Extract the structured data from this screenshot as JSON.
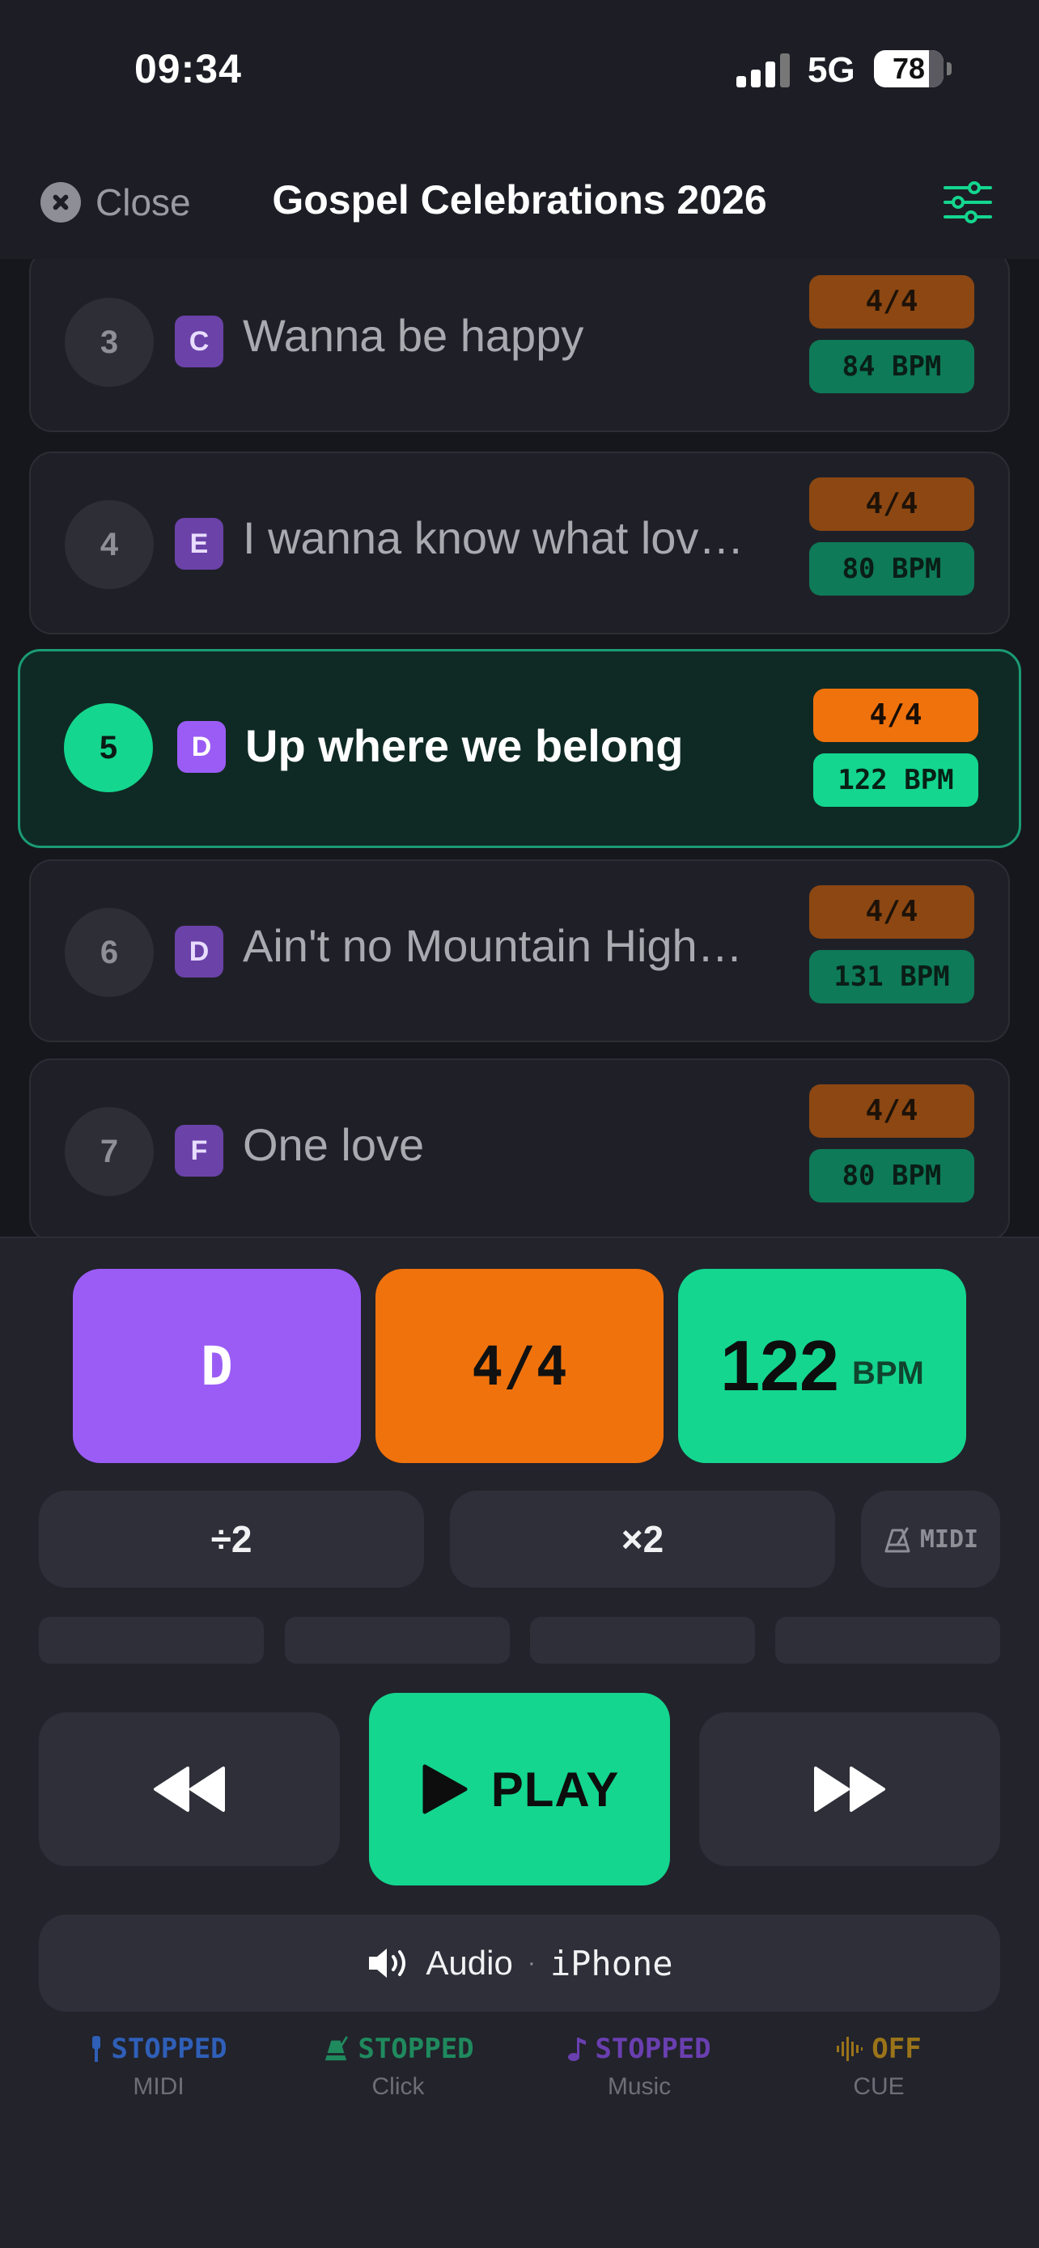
{
  "status_bar": {
    "time": "09:34",
    "network": "5G",
    "battery": "78"
  },
  "header": {
    "close_label": "Close",
    "title": "Gospel Celebrations 2026"
  },
  "setlist": [
    {
      "number": "3",
      "key": "C",
      "name": "Wanna be happy",
      "time_signature": "4/4",
      "bpm": "84 BPM",
      "active": false
    },
    {
      "number": "4",
      "key": "E",
      "name": "I wanna know what lov…",
      "time_signature": "4/4",
      "bpm": "80 BPM",
      "active": false
    },
    {
      "number": "5",
      "key": "D",
      "name": "Up where we belong",
      "time_signature": "4/4",
      "bpm": "122 BPM",
      "active": true
    },
    {
      "number": "6",
      "key": "D",
      "name": "Ain't no Mountain High…",
      "time_signature": "4/4",
      "bpm": "131 BPM",
      "active": false
    },
    {
      "number": "7",
      "key": "F",
      "name": "One love",
      "time_signature": "4/4",
      "bpm": "80 BPM",
      "active": false
    }
  ],
  "current": {
    "key": "D",
    "time_signature": "4/4",
    "bpm_value": "122",
    "bpm_unit": "BPM"
  },
  "controls": {
    "halve_label": "÷2",
    "double_label": "×2",
    "midi_label": "MIDI",
    "play_label": "PLAY",
    "audio_label": "Audio",
    "audio_separator": "·",
    "audio_device": "iPhone"
  },
  "statuses": [
    {
      "value": "STOPPED",
      "label": "MIDI",
      "color": "#2f5fb8",
      "icon": "midi-plug-icon"
    },
    {
      "value": "STOPPED",
      "label": "Click",
      "color": "#1f8a5e",
      "icon": "metronome-icon"
    },
    {
      "value": "STOPPED",
      "label": "Music",
      "color": "#6a3fb0",
      "icon": "music-note-icon"
    },
    {
      "value": "OFF",
      "label": "CUE",
      "color": "#9a7418",
      "icon": "waveform-icon"
    }
  ],
  "colors": {
    "accent_green": "#14d68f",
    "accent_orange": "#f0720c",
    "accent_purple": "#9b5cf6",
    "background": "#1d1e25"
  }
}
